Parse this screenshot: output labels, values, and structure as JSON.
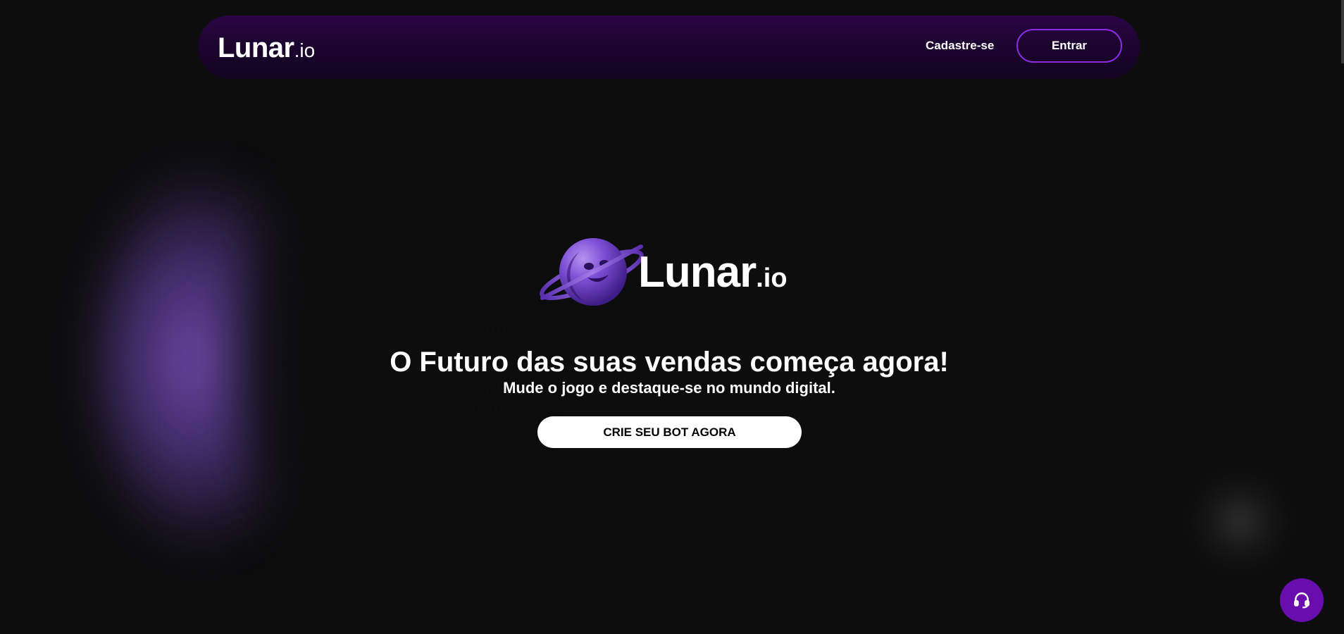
{
  "navbar": {
    "brand_main": "Lunar",
    "brand_suffix": ".io",
    "signup_label": "Cadastre-se",
    "login_label": "Entrar"
  },
  "hero": {
    "logo_main": "Lunar",
    "logo_suffix": ".io",
    "title": "O Futuro das suas vendas começa agora!",
    "subtitle": "Mude o jogo e destaque-se no mundo digital.",
    "cta_label": "CRIE SEU BOT AGORA"
  },
  "support": {
    "icon": "headset-icon"
  },
  "colors": {
    "background": "#0d0d0e",
    "navbar_top": "#2c0546",
    "accent_border": "#8a2be2",
    "fab": "#6a0dad",
    "cta_bg": "#ffffff"
  }
}
